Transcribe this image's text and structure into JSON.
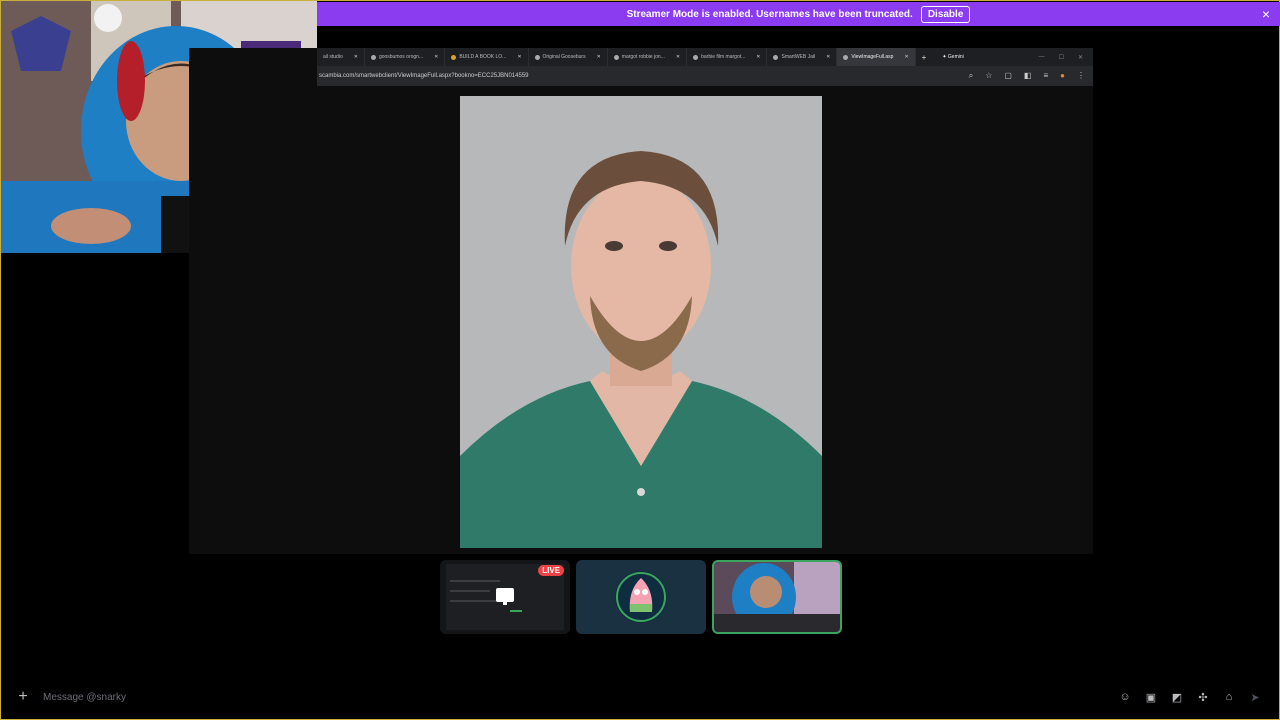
{
  "banner": {
    "message": "Streamer Mode is enabled. Usernames have been truncated.",
    "disable_label": "Disable",
    "close_icon": "×"
  },
  "browser": {
    "tabs": [
      {
        "label": "ail studio"
      },
      {
        "label": "goosbumos orogn..."
      },
      {
        "label": "BUILD A BOOK LO..."
      },
      {
        "label": "Original Gooseburs"
      },
      {
        "label": "margot robbie jon..."
      },
      {
        "label": "barbie film margot..."
      },
      {
        "label": "SmartWEB Jail"
      },
      {
        "label": "ViewImageFull.asp"
      }
    ],
    "new_tab_icon": "+",
    "gemini_label": "✦ Gemini",
    "url": "scambia.com/smartwebclient/ViewImageFull.aspx?bookno=ECC25JBN014559"
  },
  "tiles": {
    "live_badge": "LIVE"
  },
  "message_bar": {
    "add_icon": "+",
    "placeholder": "Message @snarky"
  },
  "colors": {
    "banner": "#8b3bf0",
    "live": "#ed4245",
    "speaking_border": "#3ba55d"
  }
}
